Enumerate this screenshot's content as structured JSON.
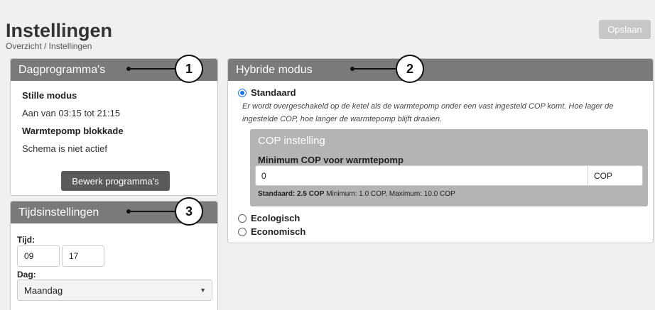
{
  "header": {
    "title": "Instellingen",
    "breadcrumb": "Overzicht / Instellingen",
    "save_label": "Opslaan"
  },
  "dagprogramma": {
    "title": "Dagprogramma's",
    "callout": "1",
    "stille_title": "Stille modus",
    "stille_value": "Aan van 03:15 tot 21:15",
    "blokkade_title": "Warmtepomp blokkade",
    "blokkade_value": "Schema is niet actief",
    "edit_label": "Bewerk programma's"
  },
  "hybride": {
    "title": "Hybride modus",
    "callout": "2",
    "options": [
      {
        "label": "Standaard",
        "selected": true
      },
      {
        "label": "Ecologisch",
        "selected": false
      },
      {
        "label": "Economisch",
        "selected": false
      }
    ],
    "description": "Er wordt overgeschakeld op de ketel als de warmtepomp onder een vast ingesteld COP komt. Hoe lager de ingestelde COP, hoe langer de warmtepomp blijft draaien.",
    "cop": {
      "title": "COP instelling",
      "label": "Minimum COP voor warmtepomp",
      "value": "0",
      "unit": "COP",
      "hint_bold": "Standaard: 2.5 COP",
      "hint_rest": " Minimum: 1.0 COP, Maximum: 10.0 COP"
    }
  },
  "tijd": {
    "title": "Tijdsinstellingen",
    "callout": "3",
    "time_label": "Tijd:",
    "hour": "09",
    "minute": "17",
    "day_label": "Dag:",
    "day_value": "Maandag"
  },
  "colors": {
    "panel_header": "#7a7a7a",
    "accent": "#1a73e8",
    "cop_box": "#b4b4b4"
  }
}
